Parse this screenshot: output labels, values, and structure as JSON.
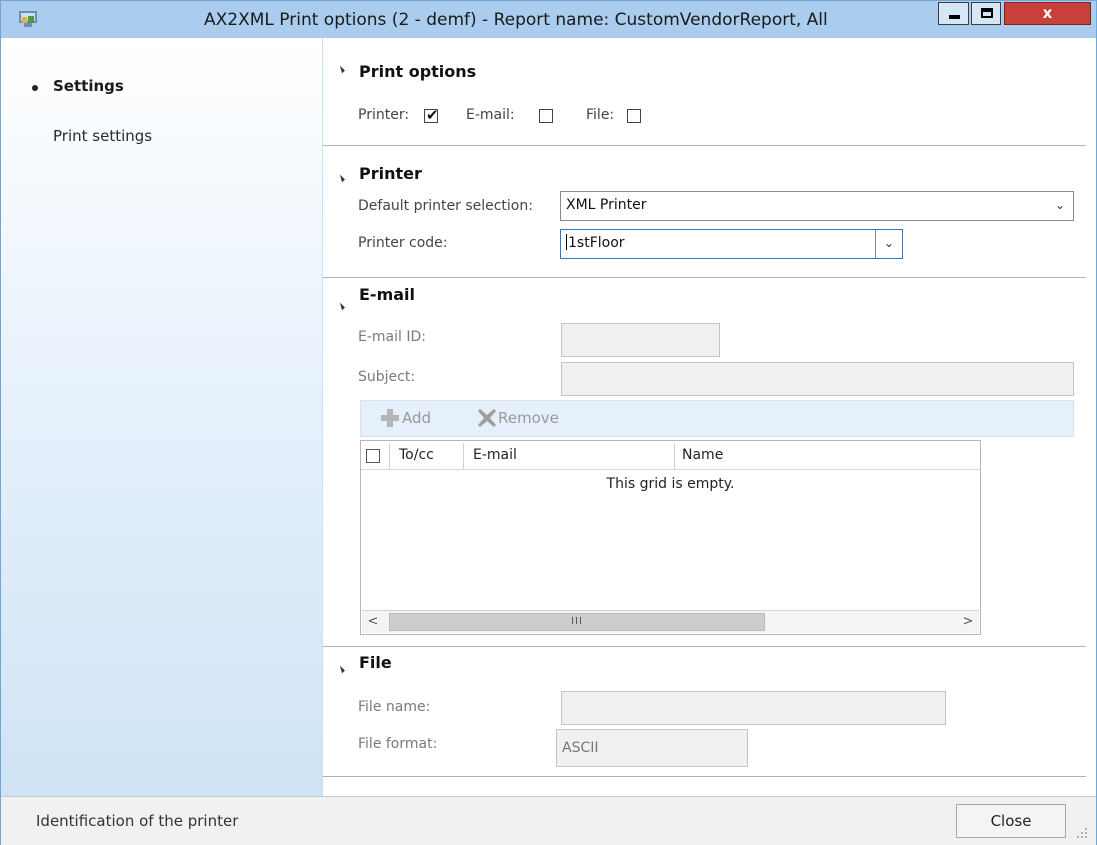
{
  "window": {
    "title": "AX2XML Print options (2 - demf) - Report name: CustomVendorReport, All",
    "controls": {
      "minimize": "minimize",
      "maximize": "maximize",
      "close": "x"
    }
  },
  "nav": {
    "items": [
      {
        "label": "Settings",
        "active": true
      },
      {
        "label": "Print settings",
        "active": false
      }
    ]
  },
  "print_options": {
    "title": "Print options",
    "printer": {
      "label": "Printer:",
      "checked": true
    },
    "email": {
      "label": "E-mail:",
      "checked": false
    },
    "file": {
      "label": "File:",
      "checked": false
    }
  },
  "printer": {
    "title": "Printer",
    "default_selection": {
      "label": "Default printer selection:",
      "value": "XML Printer"
    },
    "printer_code": {
      "label": "Printer code:",
      "value": "1stFloor"
    }
  },
  "email": {
    "title": "E-mail",
    "email_id": {
      "label": "E-mail ID:",
      "value": ""
    },
    "subject": {
      "label": "Subject:",
      "value": ""
    },
    "toolbar": {
      "add": "Add",
      "remove": "Remove"
    },
    "grid": {
      "columns": [
        "To/cc",
        "E-mail",
        "Name"
      ],
      "empty_text": "This grid is empty.",
      "scroll_thumb": "III"
    }
  },
  "file": {
    "title": "File",
    "file_name": {
      "label": "File name:",
      "value": ""
    },
    "file_format": {
      "label": "File format:",
      "value": "ASCII"
    }
  },
  "status": {
    "text": "Identification of the printer",
    "close_button": "Close"
  },
  "colors": {
    "titlebar": "#a9ccef",
    "close_button": "#c7413a",
    "nav_gradient_bottom": "#cfe3f6"
  }
}
